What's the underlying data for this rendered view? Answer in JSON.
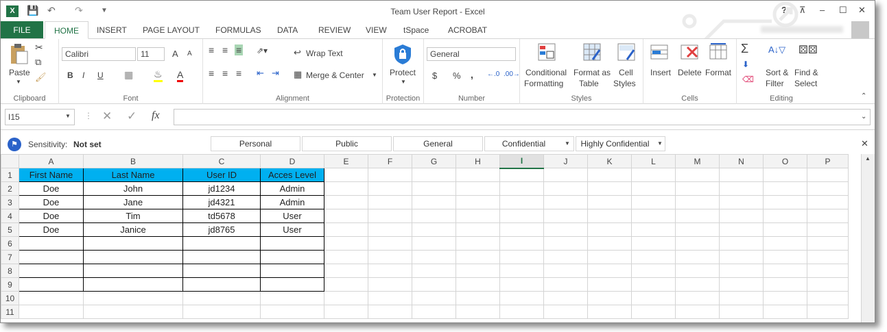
{
  "window": {
    "title": "Team User Report - Excel"
  },
  "titlebar": {
    "app_badge": "X",
    "help": "?",
    "restore_ribbon": "⊼",
    "minimize": "–",
    "maximize": "☐",
    "close": "✕"
  },
  "ribbon_tabs": [
    "FILE",
    "HOME",
    "INSERT",
    "PAGE LAYOUT",
    "FORMULAS",
    "DATA",
    "REVIEW",
    "VIEW",
    "tSpace",
    "ACROBAT"
  ],
  "clipboard": {
    "paste": "Paste",
    "label": "Clipboard"
  },
  "font": {
    "name": "Calibri",
    "size": "11",
    "bold": "B",
    "italic": "I",
    "underline": "U",
    "grow": "A",
    "shrink": "A",
    "label": "Font"
  },
  "alignment": {
    "wrap_text": "Wrap Text",
    "merge_center": "Merge & Center",
    "label": "Alignment"
  },
  "protection": {
    "protect": "Protect",
    "label": "Protection"
  },
  "number": {
    "format": "General",
    "currency": "$",
    "percent": "%",
    "comma": ",",
    "label": "Number"
  },
  "styles": {
    "conditional": "Conditional",
    "formatting": "Formatting",
    "format_as": "Format as",
    "table": "Table",
    "cell": "Cell",
    "cell_styles": "Styles",
    "label": "Styles"
  },
  "cells": {
    "insert": "Insert",
    "delete": "Delete",
    "format": "Format",
    "label": "Cells"
  },
  "editing": {
    "sort": "Sort &",
    "filter": "Filter",
    "find": "Find &",
    "select": "Select",
    "label": "Editing"
  },
  "formula_bar": {
    "name_box": "I15",
    "formula": "",
    "fx": "fx"
  },
  "sensitivity": {
    "label": "Sensitivity:",
    "value": "Not set",
    "buttons": [
      "Personal",
      "Public",
      "General",
      "Confidential",
      "Highly Confidential"
    ]
  },
  "sheet": {
    "columns": [
      "A",
      "B",
      "C",
      "D",
      "E",
      "F",
      "G",
      "H",
      "I",
      "J",
      "K",
      "L",
      "M",
      "N",
      "O",
      "P"
    ],
    "selected_column": "I",
    "rows": [
      [
        "First Name",
        "Last Name",
        "User ID",
        "Acces Level"
      ],
      [
        "Doe",
        "John",
        "jd1234",
        "Admin"
      ],
      [
        "Doe",
        "Jane",
        "jd4321",
        "Admin"
      ],
      [
        "Doe",
        "Tim",
        "td5678",
        "User"
      ],
      [
        "Doe",
        "Janice",
        "jd8765",
        "User"
      ],
      [
        "",
        "",
        "",
        ""
      ],
      [
        "",
        "",
        "",
        ""
      ],
      [
        "",
        "",
        "",
        ""
      ],
      [
        "",
        "",
        "",
        ""
      ],
      [
        "",
        "",
        "",
        ""
      ],
      [
        "",
        "",
        "",
        ""
      ]
    ],
    "header_color": "#00b0f0",
    "accent": "#217346"
  }
}
